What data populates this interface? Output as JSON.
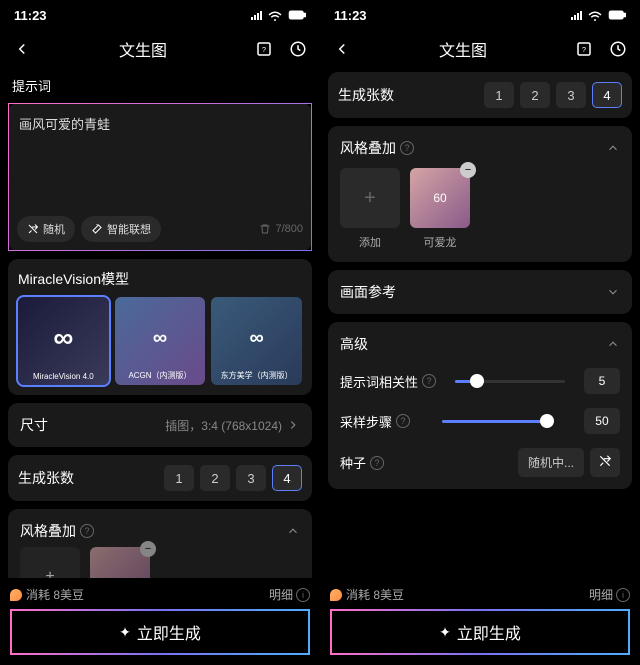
{
  "status": {
    "time": "11:23"
  },
  "header": {
    "title": "文生图"
  },
  "left": {
    "prompt_label": "提示词",
    "prompt_text": "画风可爱的青蛙",
    "random_btn": "随机",
    "smart_btn": "智能联想",
    "char_count": "7/800",
    "model_title": "MiracleVision模型",
    "models": [
      {
        "name": "MiracleVision 4.0"
      },
      {
        "name": "ACGN（内测版）"
      },
      {
        "name": "东方美学（内测版）"
      }
    ],
    "size_label": "尺寸",
    "size_value": "插图，3:4 (768x1024)",
    "count_label": "生成张数",
    "counts": [
      "1",
      "2",
      "3",
      "4"
    ],
    "style_label": "风格叠加"
  },
  "right": {
    "count_label": "生成张数",
    "counts": [
      "1",
      "2",
      "3",
      "4"
    ],
    "style_label": "风格叠加",
    "style_add": "添加",
    "style_item": {
      "name": "可爱龙",
      "value": "60"
    },
    "ref_label": "画面参考",
    "adv_label": "高级",
    "relevance_label": "提示词相关性",
    "relevance_val": "5",
    "steps_label": "采样步骤",
    "steps_val": "50",
    "seed_label": "种子",
    "seed_random": "随机中..."
  },
  "footer": {
    "cost": "消耗 8美豆",
    "detail": "明细",
    "generate": "立即生成"
  }
}
